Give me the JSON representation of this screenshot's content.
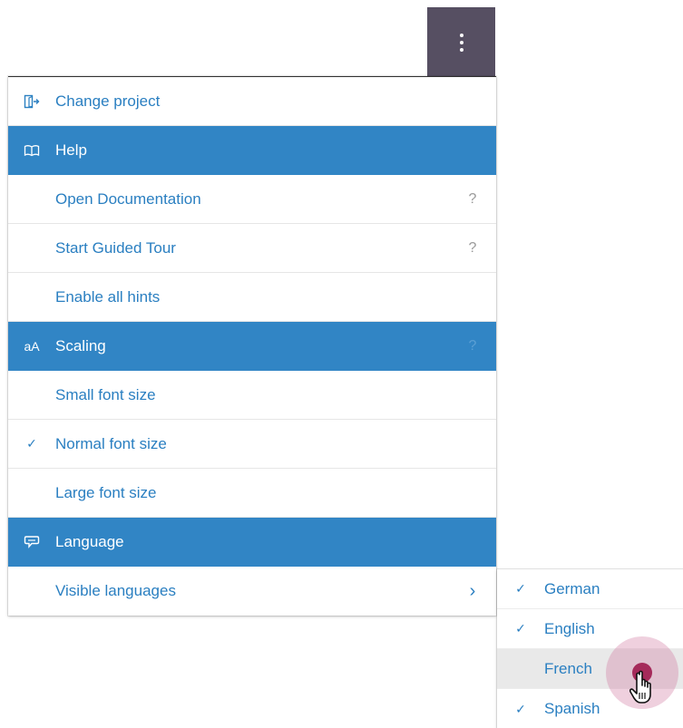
{
  "toolbar": {
    "more_icon": "kebab-vertical-icon"
  },
  "menu": {
    "items": [
      {
        "type": "item",
        "icon": "exit-door-icon",
        "glyph": "⍈",
        "label": "Change project",
        "trail": ""
      },
      {
        "type": "header",
        "icon": "book-open-icon",
        "glyph": "⌧",
        "label": "Help",
        "trail": ""
      },
      {
        "type": "item",
        "icon": "",
        "glyph": "",
        "label": "Open Documentation",
        "trail": "?"
      },
      {
        "type": "item",
        "icon": "",
        "glyph": "",
        "label": "Start Guided Tour",
        "trail": "?"
      },
      {
        "type": "item",
        "icon": "",
        "glyph": "",
        "label": "Enable all hints",
        "trail": ""
      },
      {
        "type": "header",
        "icon": "font-scale-icon",
        "glyph": "aA",
        "label": "Scaling",
        "trail": "?"
      },
      {
        "type": "item",
        "icon": "",
        "glyph": "",
        "label": "Small font size",
        "trail": ""
      },
      {
        "type": "item",
        "icon": "check-icon",
        "glyph": "✓",
        "label": "Normal font size",
        "trail": ""
      },
      {
        "type": "item",
        "icon": "",
        "glyph": "",
        "label": "Large font size",
        "trail": ""
      },
      {
        "type": "header",
        "icon": "speech-bubble-icon",
        "glyph": "⌔",
        "label": "Language",
        "trail": ""
      },
      {
        "type": "item",
        "icon": "",
        "glyph": "",
        "label": "Visible languages",
        "trail": "›"
      }
    ]
  },
  "languages": {
    "items": [
      {
        "label": "German",
        "checked": "✓"
      },
      {
        "label": "English",
        "checked": "✓"
      },
      {
        "label": "French",
        "checked": ""
      },
      {
        "label": "Spanish",
        "checked": "✓"
      }
    ]
  },
  "colors": {
    "accent": "#3185c5",
    "link": "#2a7fc1",
    "kebab_bg": "#564f62"
  }
}
